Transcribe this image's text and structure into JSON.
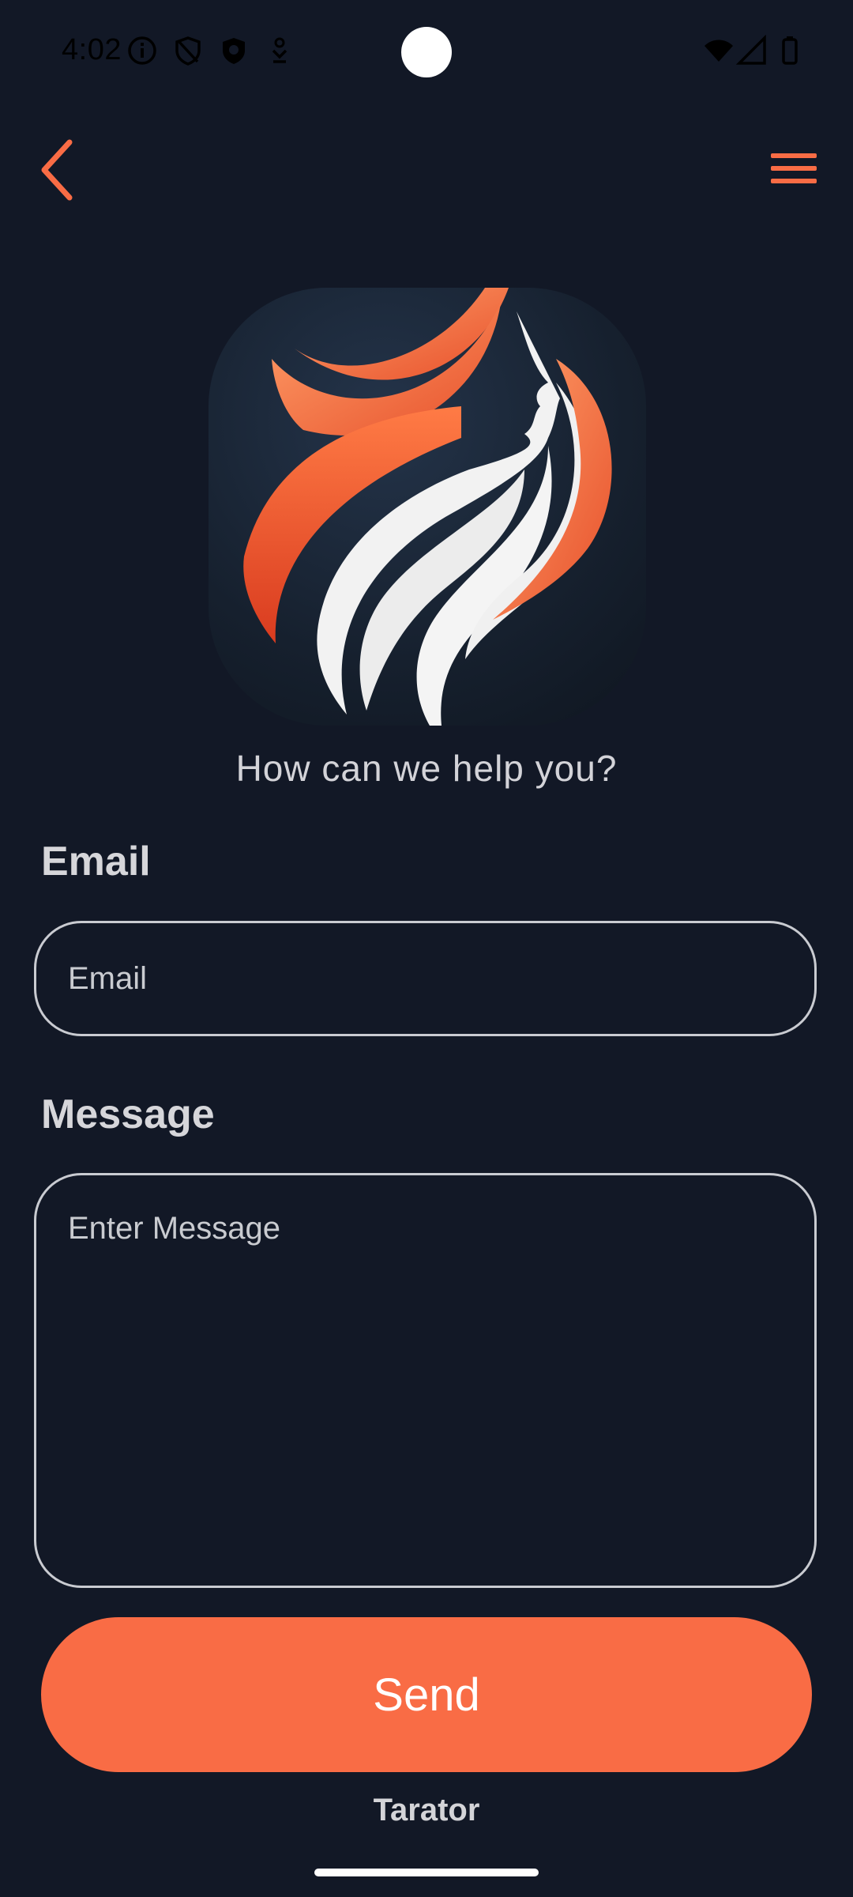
{
  "status_bar": {
    "time": "4:02",
    "icons": [
      "info-icon",
      "shield-icon",
      "vpn-shield-icon",
      "download-icon",
      "wifi-icon",
      "signal-icon",
      "battery-icon"
    ]
  },
  "nav": {
    "back_icon": "chevron-left-icon",
    "menu_icon": "hamburger-menu-icon"
  },
  "header": {
    "subtitle": "How can we help you?"
  },
  "form": {
    "email_label": "Email",
    "email_placeholder": "Email",
    "email_value": "",
    "message_label": "Message",
    "message_placeholder": "Enter Message",
    "message_value": "",
    "send_label": "Send"
  },
  "footer": {
    "brand": "Tarator"
  },
  "colors": {
    "background": "#121826",
    "accent": "#f96c45",
    "text": "#d6d6da",
    "border": "#c9cbd1"
  }
}
